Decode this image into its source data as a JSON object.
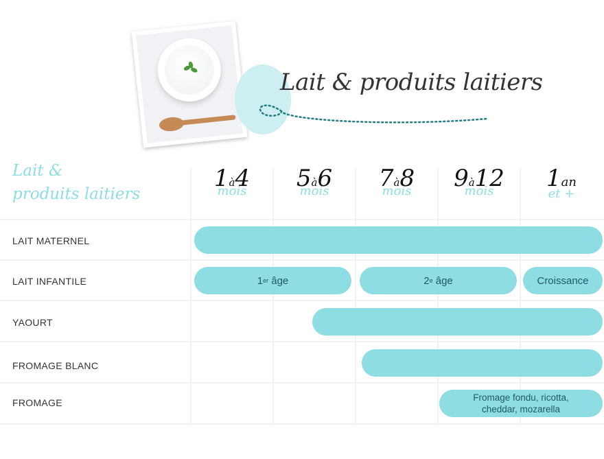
{
  "title": "Lait & produits laitiers",
  "side_title": {
    "line1": "Lait &",
    "line2": "produits laitiers"
  },
  "colors": {
    "bar": "#8ddde3",
    "bar_text": "#1d5a63",
    "accent_script": "#8ddde3",
    "dotted_line": "#1f7d83"
  },
  "columns": [
    {
      "from": "1",
      "sep": "à",
      "to": "4",
      "unit": "mois"
    },
    {
      "from": "5",
      "sep": "à",
      "to": "6",
      "unit": "mois"
    },
    {
      "from": "7",
      "sep": "à",
      "to": "8",
      "unit": "mois"
    },
    {
      "from": "9",
      "sep": "à",
      "to": "12",
      "unit": "mois"
    },
    {
      "from": "1",
      "sep": "an",
      "to": "",
      "unit": "et +"
    }
  ],
  "rows": [
    {
      "label": "LAIT MATERNEL",
      "bars": [
        {
          "text": ""
        }
      ]
    },
    {
      "label": "LAIT INFANTILE",
      "bars": [
        {
          "text": "1",
          "sup": "er",
          "rest": " âge"
        },
        {
          "text": "2",
          "sup": "e",
          "rest": " âge"
        },
        {
          "text": "Croissance"
        }
      ]
    },
    {
      "label": "YAOURT",
      "bars": [
        {
          "text": ""
        }
      ]
    },
    {
      "label": "FROMAGE BLANC",
      "bars": [
        {
          "text": ""
        }
      ]
    },
    {
      "label": "FROMAGE",
      "bars": [
        {
          "line1": "Fromage fondu, ricotta,",
          "line2": "cheddar, mozarella"
        }
      ]
    }
  ]
}
